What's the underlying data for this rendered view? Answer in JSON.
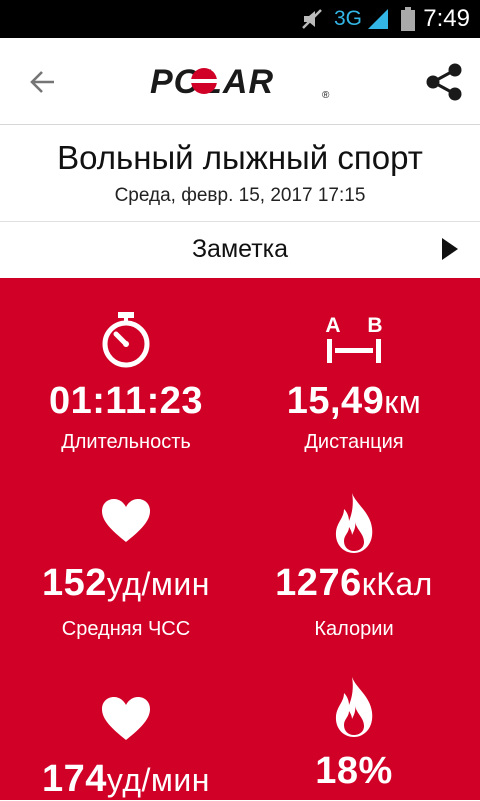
{
  "status_bar": {
    "network": "3G",
    "time": "7:49"
  },
  "header": {
    "logo_text": "POLAR",
    "registered_mark": "®"
  },
  "session": {
    "title": "Вольный лыжный спорт",
    "datetime": "Среда, февр. 15, 2017 17:15"
  },
  "note": {
    "label": "Заметка"
  },
  "colors": {
    "accent": "#d10027"
  },
  "stats": [
    {
      "value": "01:11:23",
      "unit": "",
      "label": "Длительность",
      "icon": "stopwatch-icon"
    },
    {
      "value": "15,49",
      "unit": "км",
      "label": "Дистанция",
      "icon": "distance-ab-icon"
    },
    {
      "value": "152",
      "unit": "уд/мин",
      "label": "Средняя ЧСС",
      "icon": "heart-icon"
    },
    {
      "value": "1276",
      "unit": "кКал",
      "label": "Калории",
      "icon": "flame-icon"
    },
    {
      "value": "174",
      "unit": "уд/мин",
      "label": "",
      "icon": "heart-icon"
    },
    {
      "value": "18%",
      "unit": "",
      "label": "",
      "icon": "flame-icon"
    }
  ],
  "distance_icon_labels": {
    "a": "A",
    "b": "B"
  }
}
